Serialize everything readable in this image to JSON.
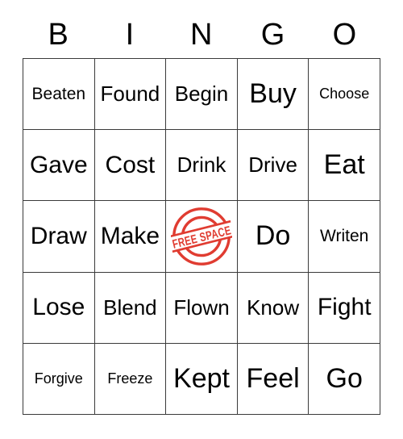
{
  "card": {
    "title_letters": [
      "B",
      "I",
      "N",
      "G",
      "O"
    ],
    "free_space_label": "FREE SPACE",
    "stamp_color": "#E03C31",
    "border_color": "#3A3A3A",
    "background_color": "#FFFFFF",
    "text_color": "#000000",
    "grid_size": "5x5",
    "rows": [
      [
        {
          "label": "Beaten",
          "size": "sm",
          "free": false
        },
        {
          "label": "Found",
          "size": "md",
          "free": false
        },
        {
          "label": "Begin",
          "size": "md",
          "free": false
        },
        {
          "label": "Buy",
          "size": "xl",
          "free": false
        },
        {
          "label": "Choose",
          "size": "xs",
          "free": false
        }
      ],
      [
        {
          "label": "Gave",
          "size": "lg",
          "free": false
        },
        {
          "label": "Cost",
          "size": "lg",
          "free": false
        },
        {
          "label": "Drink",
          "size": "md",
          "free": false
        },
        {
          "label": "Drive",
          "size": "md",
          "free": false
        },
        {
          "label": "Eat",
          "size": "xl",
          "free": false
        }
      ],
      [
        {
          "label": "Draw",
          "size": "lg",
          "free": false
        },
        {
          "label": "Make",
          "size": "lg",
          "free": false
        },
        {
          "label": "FREE SPACE",
          "size": "md",
          "free": true
        },
        {
          "label": "Do",
          "size": "xl",
          "free": false
        },
        {
          "label": "Writen",
          "size": "sm",
          "free": false
        }
      ],
      [
        {
          "label": "Lose",
          "size": "lg",
          "free": false
        },
        {
          "label": "Blend",
          "size": "md",
          "free": false
        },
        {
          "label": "Flown",
          "size": "md",
          "free": false
        },
        {
          "label": "Know",
          "size": "md",
          "free": false
        },
        {
          "label": "Fight",
          "size": "lg",
          "free": false
        }
      ],
      [
        {
          "label": "Forgive",
          "size": "xs",
          "free": false
        },
        {
          "label": "Freeze",
          "size": "xs",
          "free": false
        },
        {
          "label": "Kept",
          "size": "xl",
          "free": false
        },
        {
          "label": "Feel",
          "size": "xl",
          "free": false
        },
        {
          "label": "Go",
          "size": "xl",
          "free": false
        }
      ]
    ]
  }
}
